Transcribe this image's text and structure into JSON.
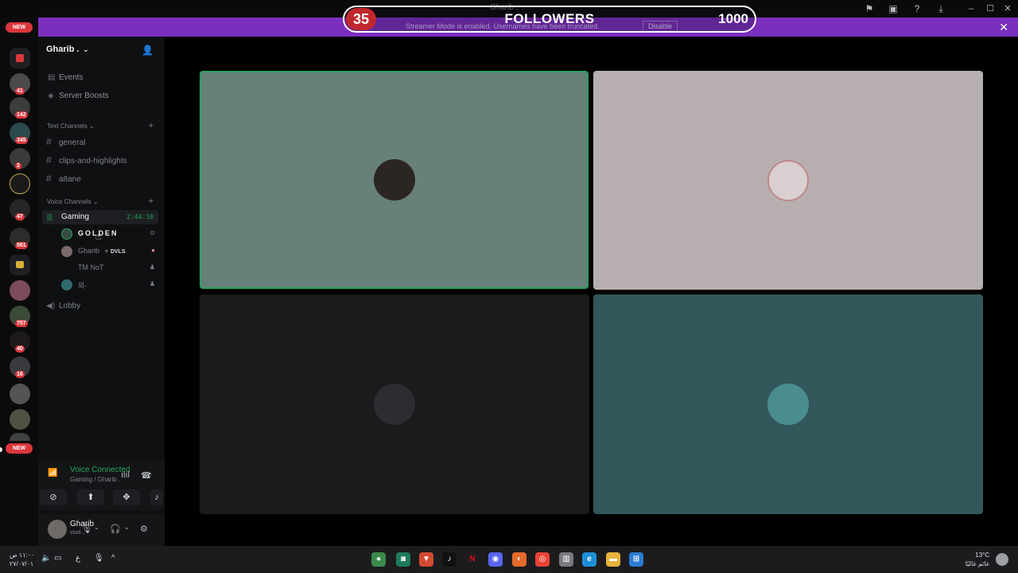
{
  "window": {
    "title": "Gharib ."
  },
  "banner": {
    "message": "Streamer Mode is enabled. Usernames have been truncated.",
    "disable_label": "Disable"
  },
  "overlay": {
    "count": "35",
    "label": "FOLLOWERS",
    "goal": "1000"
  },
  "rail": {
    "new_top": "NEW",
    "new_bottom": "NEW",
    "badges": [
      "41",
      "142",
      "345",
      "2",
      "47",
      "561",
      "757",
      "40",
      "16"
    ]
  },
  "server": {
    "name": "Gharib .",
    "nav": [
      {
        "label": "Events",
        "icon": "calendar-icon"
      },
      {
        "label": "Server Boosts",
        "icon": "boost-icon"
      }
    ],
    "text_category": "Text Channels",
    "text_channels": [
      "general",
      "clips-and-highlights",
      "a8ane"
    ],
    "voice_category": "Voice Channels",
    "voice_channel": {
      "name": "Gaming",
      "timer": "2:44:10"
    },
    "voice_users": [
      {
        "name": "GOLDEN"
      },
      {
        "name": "Gharib",
        "tag": "DVLS"
      },
      {
        "name": "TM NoT"
      },
      {
        "name": "외-"
      }
    ],
    "lobby": "Lobby"
  },
  "voice_panel": {
    "status": "Voice Connected",
    "sub": "Gaming / Gharib ."
  },
  "user_panel": {
    "name": "Gharib",
    "status": "stud..."
  },
  "taskbar": {
    "time": "١١:٠٠ ص",
    "date": "٢٧/٠٧/٠١",
    "lang": "ع",
    "weather_temp": "13°C",
    "weather_desc": "غائم غالبًا"
  },
  "colors": {
    "tile1": "#68807a",
    "tile2": "#b7afaf",
    "tile3": "#1b1b1d",
    "tile4": "#32575a",
    "speaking": "#23a55a",
    "banner": "#7b2fbe"
  }
}
